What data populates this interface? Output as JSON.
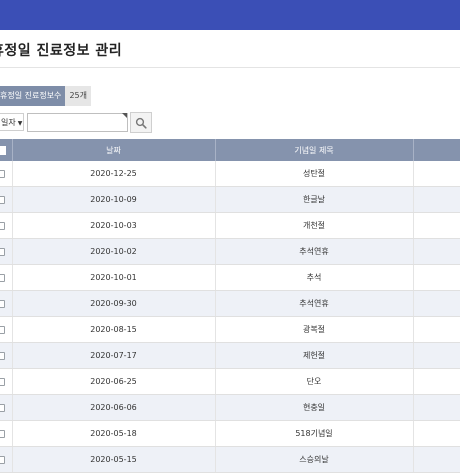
{
  "page": {
    "title": "휴정일 진료정보 관리"
  },
  "summary": {
    "count_label": "휴정일 진료정보수",
    "count_value": "25개"
  },
  "search": {
    "select_value": "일자",
    "input_value": ""
  },
  "table": {
    "headers": {
      "date": "날짜",
      "holiday_title": "기념일 제목"
    },
    "rows": [
      {
        "date": "2020-12-25",
        "title": "성탄절"
      },
      {
        "date": "2020-10-09",
        "title": "한글날"
      },
      {
        "date": "2020-10-03",
        "title": "개천절"
      },
      {
        "date": "2020-10-02",
        "title": "추석연휴"
      },
      {
        "date": "2020-10-01",
        "title": "추석"
      },
      {
        "date": "2020-09-30",
        "title": "추석연휴"
      },
      {
        "date": "2020-08-15",
        "title": "광복절"
      },
      {
        "date": "2020-07-17",
        "title": "제헌절"
      },
      {
        "date": "2020-06-25",
        "title": "단오"
      },
      {
        "date": "2020-06-06",
        "title": "현충일"
      },
      {
        "date": "2020-05-18",
        "title": "518기념일"
      },
      {
        "date": "2020-05-15",
        "title": "스승의날"
      }
    ]
  },
  "colors": {
    "topbar": "#3b4fb6",
    "table_header": "#8593ad",
    "row_alt": "#eef1f7"
  }
}
